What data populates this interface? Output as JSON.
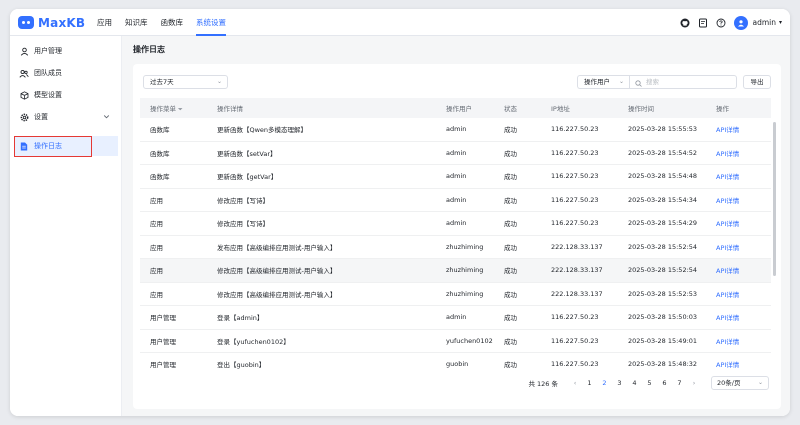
{
  "app": {
    "logo_text": "MaxKB"
  },
  "topnav": [
    "应用",
    "知识库",
    "函数库",
    "系统设置"
  ],
  "header": {
    "user_name": "admin"
  },
  "sidebar": {
    "items": [
      {
        "label": "用户管理",
        "icon": "user-icon"
      },
      {
        "label": "团队成员",
        "icon": "team-icon"
      },
      {
        "label": "模型设置",
        "icon": "cube-icon"
      },
      {
        "label": "设置",
        "icon": "gear-icon"
      },
      {
        "label": "操作日志",
        "icon": "document-icon"
      }
    ]
  },
  "main": {
    "title": "操作日志",
    "date_filter": "过去7天",
    "user_filter": "操作用户",
    "search_placeholder": "搜索",
    "export_label": "导出"
  },
  "table": {
    "columns": [
      "操作菜单",
      "操作详情",
      "操作用户",
      "状态",
      "IP地址",
      "操作时间",
      "操作"
    ],
    "rows": [
      [
        "函数库",
        "更新函数【Qwen多模态理解】",
        "admin",
        "成功",
        "116.227.50.23",
        "2025-03-28 15:55:53",
        "API详情"
      ],
      [
        "函数库",
        "更新函数【setVar】",
        "admin",
        "成功",
        "116.227.50.23",
        "2025-03-28 15:54:52",
        "API详情"
      ],
      [
        "函数库",
        "更新函数【getVar】",
        "admin",
        "成功",
        "116.227.50.23",
        "2025-03-28 15:54:48",
        "API详情"
      ],
      [
        "应用",
        "修改应用【写诗】",
        "admin",
        "成功",
        "116.227.50.23",
        "2025-03-28 15:54:34",
        "API详情"
      ],
      [
        "应用",
        "修改应用【写诗】",
        "admin",
        "成功",
        "116.227.50.23",
        "2025-03-28 15:54:29",
        "API详情"
      ],
      [
        "应用",
        "发布应用【高级编排应用测试-用户输入】",
        "zhuzhiming",
        "成功",
        "222.128.33.137",
        "2025-03-28 15:52:54",
        "API详情"
      ],
      [
        "应用",
        "修改应用【高级编排应用测试-用户输入】",
        "zhuzhiming",
        "成功",
        "222.128.33.137",
        "2025-03-28 15:52:54",
        "API详情"
      ],
      [
        "应用",
        "修改应用【高级编排应用测试-用户输入】",
        "zhuzhiming",
        "成功",
        "222.128.33.137",
        "2025-03-28 15:52:53",
        "API详情"
      ],
      [
        "用户管理",
        "登录【admin】",
        "admin",
        "成功",
        "116.227.50.23",
        "2025-03-28 15:50:03",
        "API详情"
      ],
      [
        "用户管理",
        "登录【yufuchen0102】",
        "yufuchen0102",
        "成功",
        "116.227.50.23",
        "2025-03-28 15:49:01",
        "API详情"
      ],
      [
        "用户管理",
        "登出【guobin】",
        "guobin",
        "成功",
        "116.227.50.23",
        "2025-03-28 15:48:32",
        "API详情"
      ]
    ]
  },
  "pager": {
    "total": "共 126 条",
    "pages": [
      "1",
      "2",
      "3",
      "4",
      "5",
      "6",
      "7"
    ],
    "active_page": "2",
    "prev": "‹",
    "next": "›",
    "page_size": "20条/页"
  }
}
